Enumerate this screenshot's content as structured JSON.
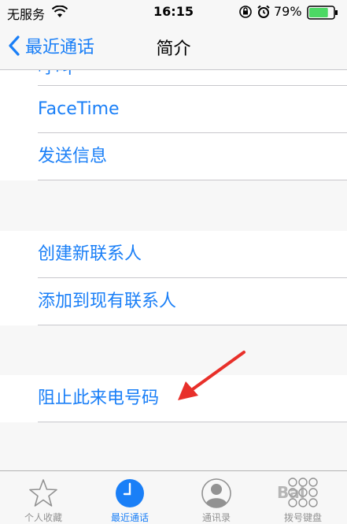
{
  "status_bar": {
    "carrier": "无服务",
    "time": "16:15",
    "battery_percent": "79%",
    "battery_level": 0.79,
    "icons": [
      "wifi-icon",
      "orientation-lock-icon",
      "alarm-icon",
      "battery-icon"
    ]
  },
  "nav": {
    "back_label": "最近通话",
    "title": "简介"
  },
  "partial_row": {
    "label": "呼叫"
  },
  "actions": {
    "facetime": "FaceTime",
    "send_message": "发送信息",
    "create_contact": "创建新联系人",
    "add_existing": "添加到现有联系人",
    "block_caller": "阻止此来电号码"
  },
  "tabs": [
    {
      "label": "个人收藏",
      "icon": "star-icon",
      "active": false
    },
    {
      "label": "最近通话",
      "icon": "clock-icon",
      "active": true
    },
    {
      "label": "通讯录",
      "icon": "contact-icon",
      "active": false
    },
    {
      "label": "拨号键盘",
      "icon": "keypad-icon",
      "active": false
    }
  ],
  "watermark": "Bai",
  "colors": {
    "accent": "#1a7ff7",
    "battery": "#4cd964",
    "annotation_arrow": "#e8302a",
    "separator": "#c8c7cc"
  }
}
